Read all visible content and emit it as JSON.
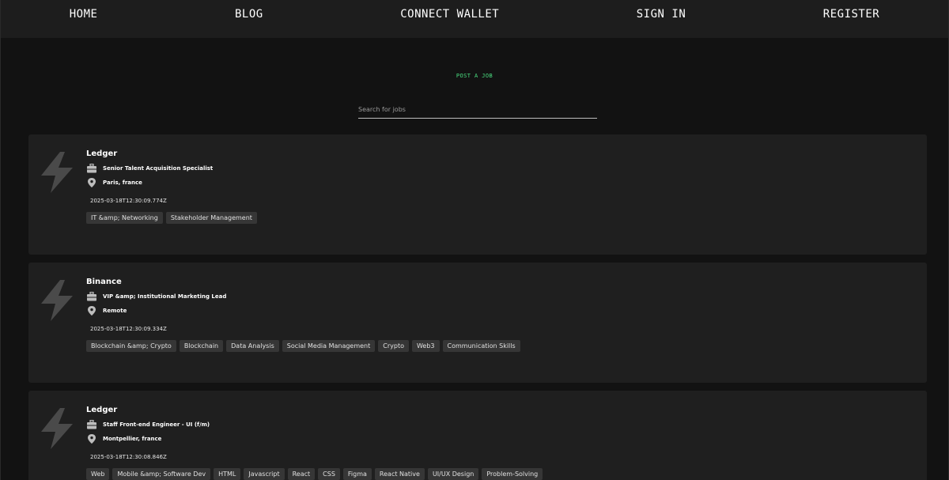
{
  "nav": {
    "home": "HOME",
    "blog": "BLOG",
    "connect_wallet": "CONNECT WALLET",
    "sign_in": "SIGN IN",
    "register": "REGISTER"
  },
  "post_job_label": "POST A JOB",
  "search": {
    "placeholder": "Search for jobs",
    "value": ""
  },
  "colors": {
    "accent": "#4ade80",
    "card_bg": "#1f1f1f",
    "page_bg": "#121212",
    "tag_bg": "#363636"
  },
  "jobs": [
    {
      "company": "Ledger",
      "title": "Senior Talent Acquisition Specialist",
      "location": "Paris, france",
      "date": "2025-03-18T12:30:09.774Z",
      "tags": [
        "IT &amp; Networking",
        "Stakeholder Management"
      ]
    },
    {
      "company": "Binance",
      "title": "VIP &amp; Institutional Marketing Lead",
      "location": "Remote",
      "date": "2025-03-18T12:30:09.334Z",
      "tags": [
        "Blockchain &amp; Crypto",
        "Blockchain",
        "Data Analysis",
        "Social Media Management",
        "Crypto",
        "Web3",
        "Communication Skills"
      ]
    },
    {
      "company": "Ledger",
      "title": "Staff Front-end Engineer - UI (f/m)",
      "location": "Montpellier, france",
      "date": "2025-03-18T12:30:08.846Z",
      "tags": [
        "Web",
        "Mobile &amp; Software Dev",
        "HTML",
        "Javascript",
        "React",
        "CSS",
        "Figma",
        "React Native",
        "UI/UX Design",
        "Problem-Solving"
      ]
    }
  ],
  "icons": {
    "logo": "lightning-bolt-icon",
    "title": "briefcase-icon",
    "location": "map-pin-icon"
  }
}
